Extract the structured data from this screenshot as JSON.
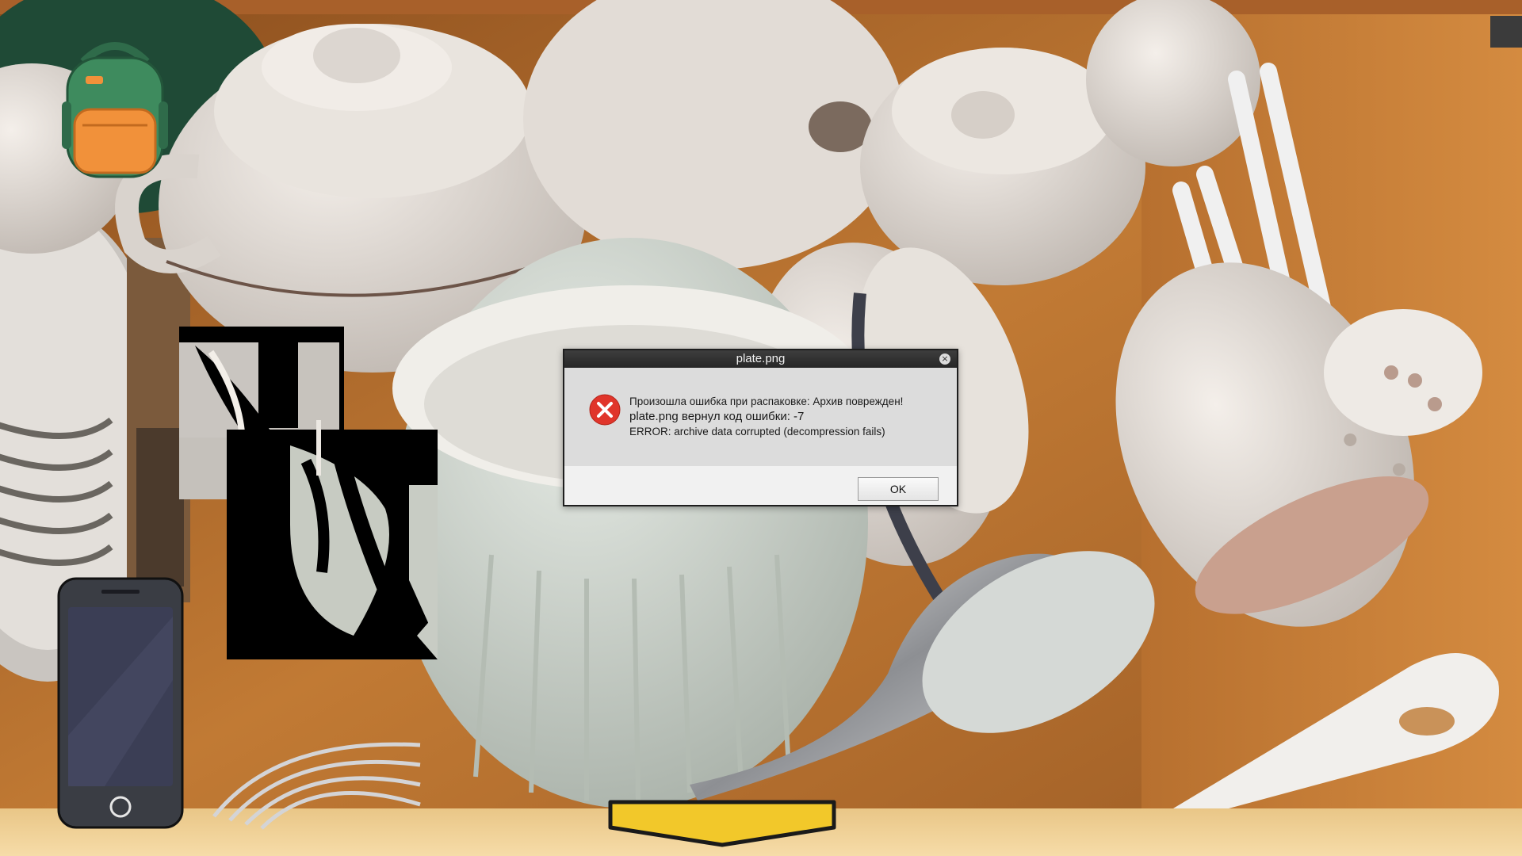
{
  "scene": {
    "name": "kitchen-drawer-dishes"
  },
  "hud": {
    "backpack_icon": "backpack-icon",
    "phone_icon": "phone-icon",
    "nav_down_icon": "chevron-down-icon"
  },
  "dialog": {
    "title": "plate.png",
    "close_icon": "close-icon",
    "error_icon": "error-icon",
    "line1": "Произошла ошибка при распаковке: Архив поврежден!",
    "line2": "plate.png вернул код ошибки: -7",
    "line3": "ERROR: archive data corrupted (decompression fails)",
    "ok_label": "OK"
  },
  "colors": {
    "wood": "#b06a2c",
    "ceramic": "#e8e2dc",
    "arrow_yellow": "#f2c82a",
    "error_red": "#e0352b"
  }
}
